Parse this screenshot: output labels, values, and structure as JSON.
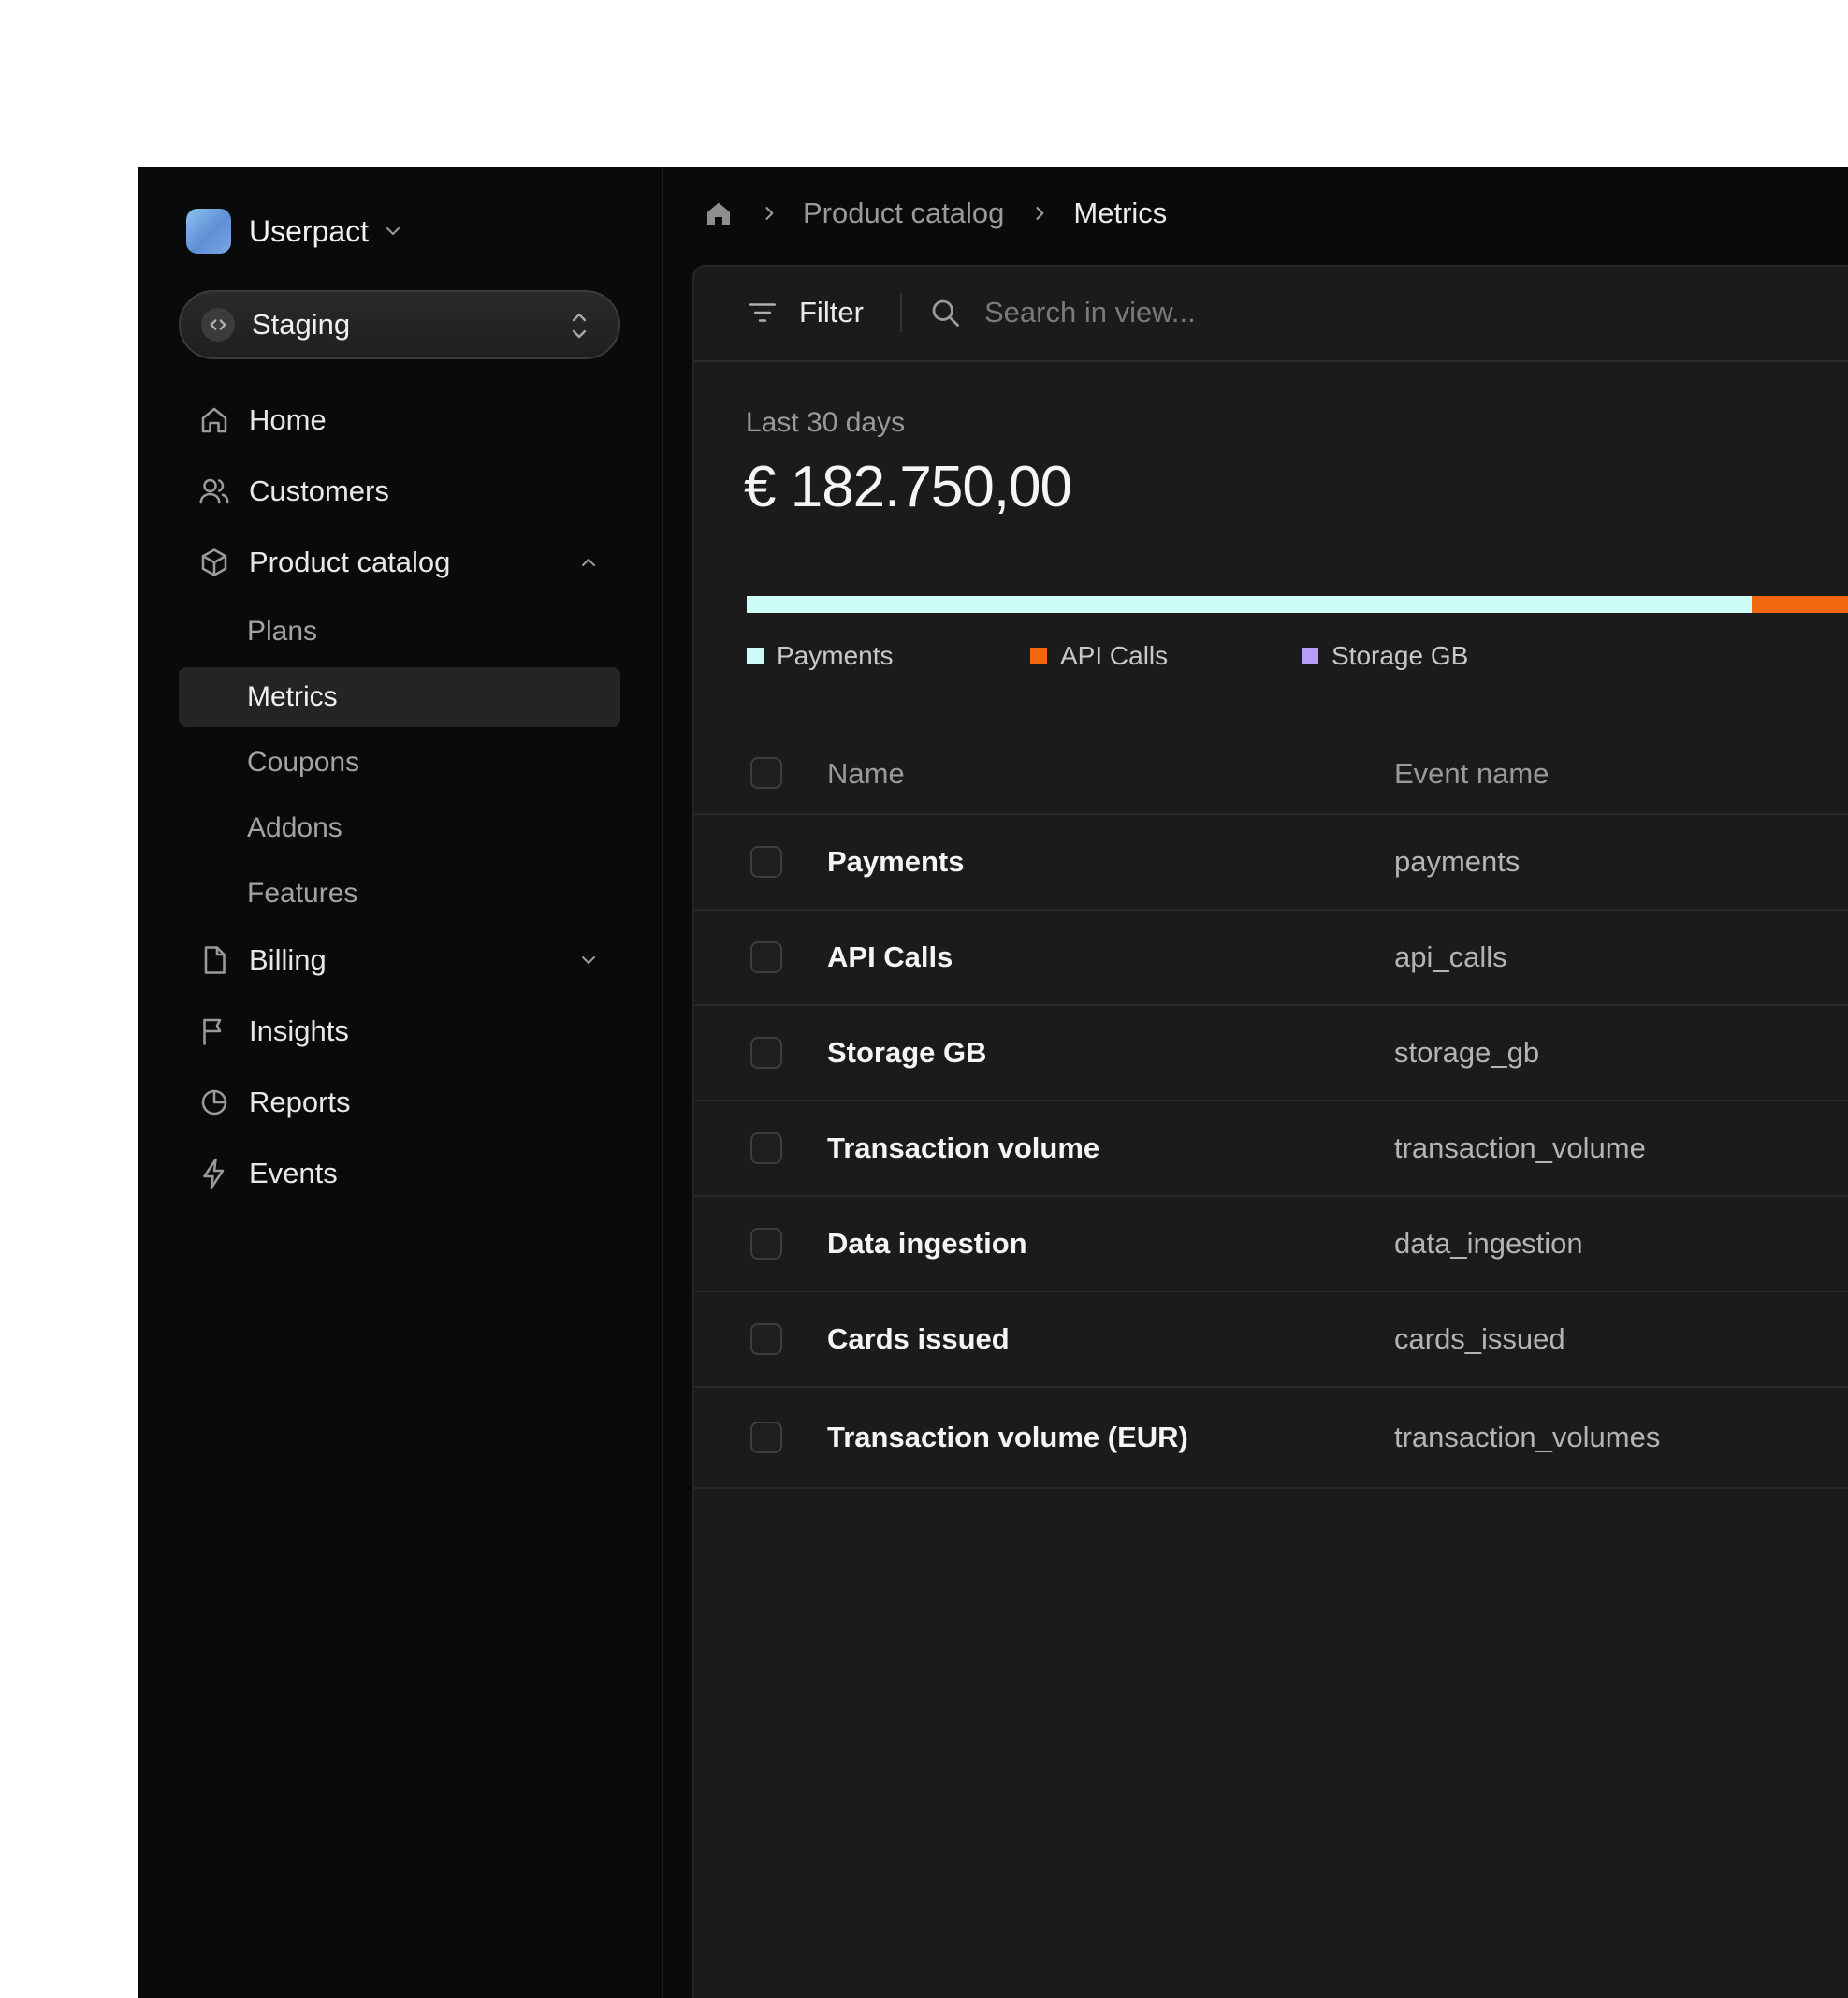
{
  "workspace": {
    "name": "Userpact"
  },
  "environment": {
    "label": "Staging"
  },
  "nav": {
    "home": "Home",
    "customers": "Customers",
    "product_catalog": "Product catalog",
    "billing": "Billing",
    "insights": "Insights",
    "reports": "Reports",
    "events": "Events"
  },
  "product_catalog_sub": {
    "plans": "Plans",
    "metrics": "Metrics",
    "coupons": "Coupons",
    "addons": "Addons",
    "features": "Features",
    "active": "Metrics"
  },
  "breadcrumb": {
    "parent": "Product catalog",
    "current": "Metrics"
  },
  "toolbar": {
    "filter_label": "Filter",
    "search_placeholder": "Search in view..."
  },
  "summary": {
    "period": "Last 30 days",
    "total": "€ 182.750,00",
    "breakdown": [
      {
        "label": "Payments",
        "share": 0.859,
        "color": "#cdfbf7"
      },
      {
        "label": "API Calls",
        "share": 0.118,
        "color": "#f2670f"
      },
      {
        "label": "Storage GB",
        "share": 0.023,
        "color": "#b69cfb"
      }
    ]
  },
  "table": {
    "columns": {
      "name": "Name",
      "event_name": "Event name"
    },
    "rows": [
      {
        "name": "Payments",
        "event_name": "payments"
      },
      {
        "name": "API Calls",
        "event_name": "api_calls"
      },
      {
        "name": "Storage GB",
        "event_name": "storage_gb"
      },
      {
        "name": "Transaction volume",
        "event_name": "transaction_volume"
      },
      {
        "name": "Data ingestion",
        "event_name": "data_ingestion"
      },
      {
        "name": "Cards issued",
        "event_name": "cards_issued"
      },
      {
        "name": "Transaction volume (EUR)",
        "event_name": "transaction_volumes"
      }
    ]
  },
  "colors": {
    "sidebar_bg": "#0a0a0a",
    "panel_bg": "#1b1b1b",
    "active_item_bg": "#242424",
    "workspace_logo": "#7ba6e3"
  }
}
